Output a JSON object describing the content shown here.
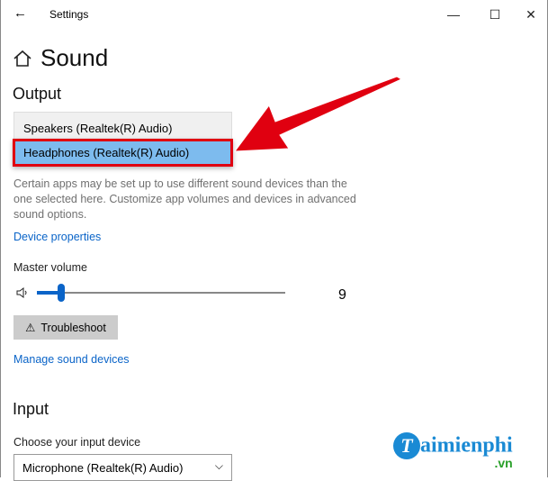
{
  "window": {
    "title": "Settings",
    "minimize": "—",
    "maximize": "☐",
    "close": "✕",
    "back": "←"
  },
  "page": {
    "title": "Sound"
  },
  "output": {
    "heading": "Output",
    "options": [
      "Speakers (Realtek(R) Audio)",
      "Headphones (Realtek(R) Audio)"
    ],
    "description": "Certain apps may be set up to use different sound devices than the one selected here. Customize app volumes and devices in advanced sound options.",
    "device_properties": "Device properties",
    "master_volume_label": "Master volume",
    "volume": "9",
    "volume_fraction": 0.09,
    "troubleshoot": "Troubleshoot",
    "manage_devices": "Manage sound devices"
  },
  "input": {
    "heading": "Input",
    "choose_label": "Choose your input device",
    "selected": "Microphone (Realtek(R) Audio)"
  },
  "watermark": {
    "text": "Taimienphi",
    "suffix": ".vn"
  },
  "colors": {
    "accent": "#0a64c8",
    "highlight": "#7dbbee",
    "annotation": "#e00010"
  }
}
